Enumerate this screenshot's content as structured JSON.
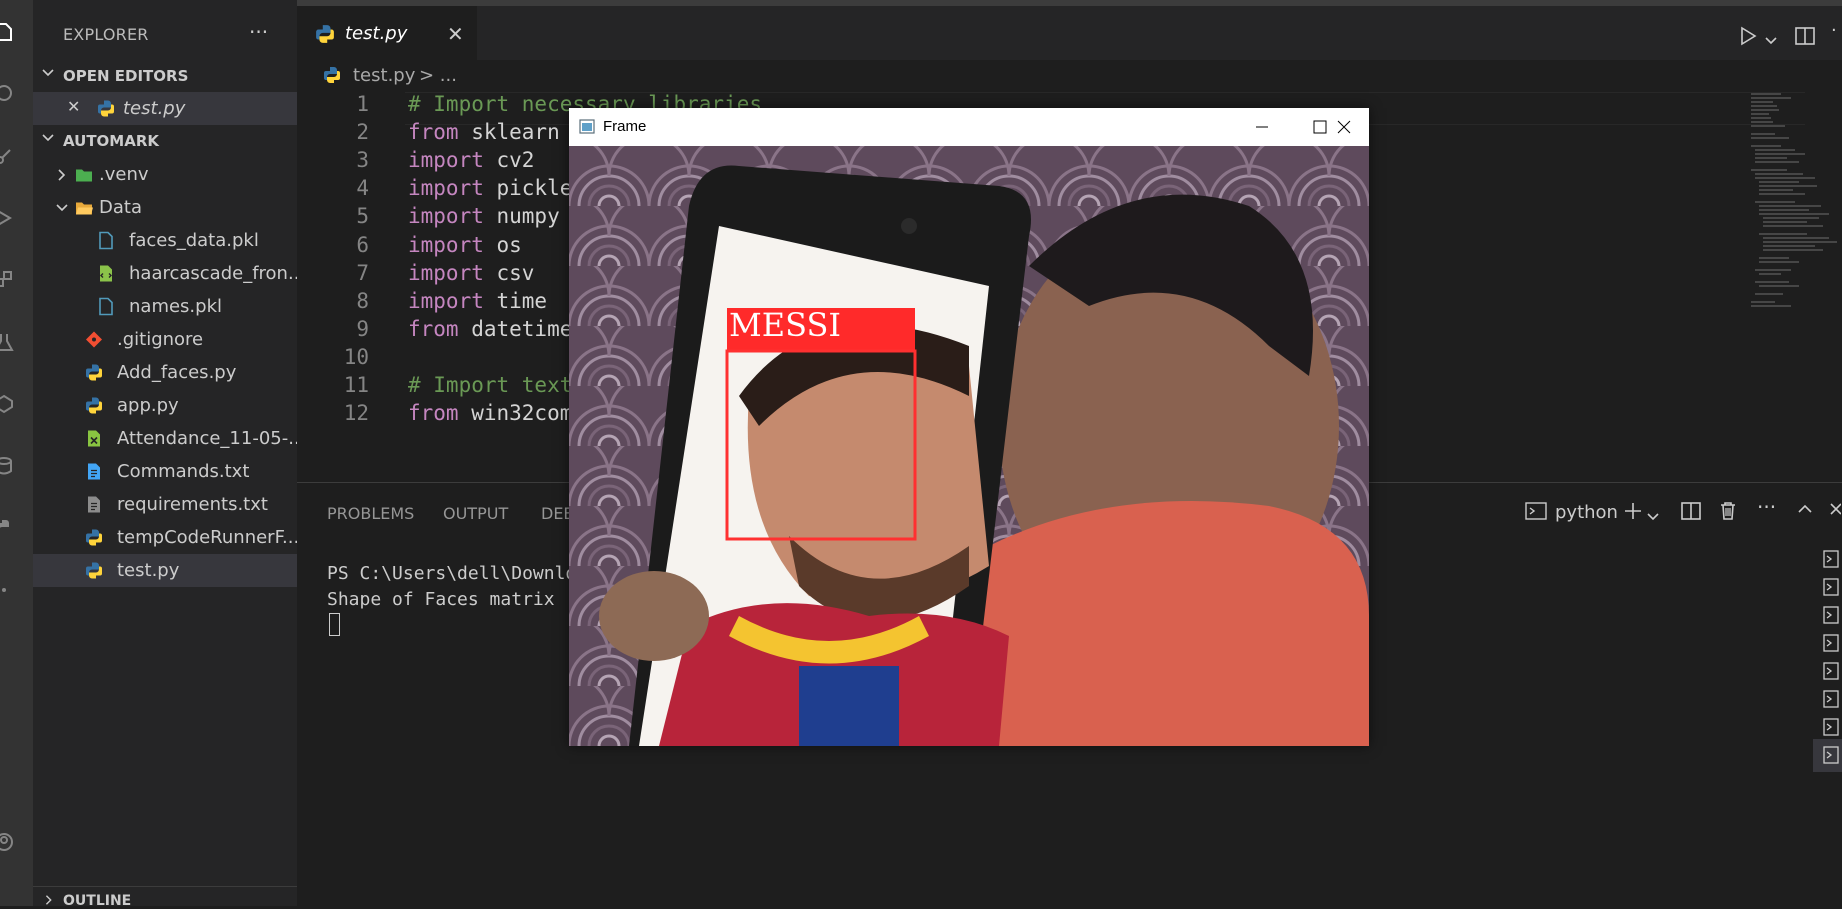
{
  "sidebar": {
    "title": "EXPLORER",
    "more_glyph": "···",
    "open_editors_label": "OPEN EDITORS",
    "open_editors": [
      {
        "name": "test.py",
        "icon": "python-file-icon",
        "close": "✕"
      }
    ],
    "workspace_label": "AUTOMARK",
    "tree": [
      {
        "name": ".venv",
        "icon": "folder-env-icon",
        "type": "folder",
        "expanded": false
      },
      {
        "name": "Data",
        "icon": "folder-open-icon",
        "type": "folder",
        "expanded": true
      },
      {
        "name": "faces_data.pkl",
        "icon": "file-icon",
        "type": "file"
      },
      {
        "name": "haarcascade_fron...",
        "icon": "xml-file-icon",
        "type": "file"
      },
      {
        "name": "names.pkl",
        "icon": "file-icon",
        "type": "file"
      },
      {
        "name": ".gitignore",
        "icon": "git-icon",
        "type": "file"
      },
      {
        "name": "Add_faces.py",
        "icon": "python-file-icon",
        "type": "file"
      },
      {
        "name": "app.py",
        "icon": "python-file-icon",
        "type": "file"
      },
      {
        "name": "Attendance_11-05-...",
        "icon": "csv-file-icon",
        "type": "file"
      },
      {
        "name": "Commands.txt",
        "icon": "text-file-icon",
        "type": "file"
      },
      {
        "name": "requirements.txt",
        "icon": "requirements-file-icon",
        "type": "file"
      },
      {
        "name": "tempCodeRunnerF...",
        "icon": "python-file-icon",
        "type": "file"
      },
      {
        "name": "test.py",
        "icon": "python-file-icon",
        "type": "file",
        "selected": true
      }
    ],
    "outline_label": "OUTLINE"
  },
  "editor": {
    "tab": {
      "name": "test.py",
      "close": "✕"
    },
    "breadcrumb": [
      "test.py",
      "> ..."
    ],
    "lines": [
      {
        "n": "1",
        "parts": [
          {
            "t": "# Import necessary libraries",
            "c": "cm"
          }
        ]
      },
      {
        "n": "2",
        "parts": [
          {
            "t": "from",
            "c": "kwp"
          },
          {
            "t": " sklearn",
            "c": ""
          }
        ]
      },
      {
        "n": "3",
        "parts": [
          {
            "t": "import",
            "c": "kwp"
          },
          {
            "t": " cv2",
            "c": ""
          }
        ]
      },
      {
        "n": "4",
        "parts": [
          {
            "t": "import",
            "c": "kwp"
          },
          {
            "t": " pickle",
            "c": ""
          }
        ]
      },
      {
        "n": "5",
        "parts": [
          {
            "t": "import",
            "c": "kwp"
          },
          {
            "t": " numpy",
            "c": ""
          }
        ]
      },
      {
        "n": "6",
        "parts": [
          {
            "t": "import",
            "c": "kwp"
          },
          {
            "t": " os",
            "c": ""
          }
        ]
      },
      {
        "n": "7",
        "parts": [
          {
            "t": "import",
            "c": "kwp"
          },
          {
            "t": " csv",
            "c": ""
          }
        ]
      },
      {
        "n": "8",
        "parts": [
          {
            "t": "import",
            "c": "kwp"
          },
          {
            "t": " time",
            "c": ""
          }
        ]
      },
      {
        "n": "9",
        "parts": [
          {
            "t": "from",
            "c": "kwp"
          },
          {
            "t": " datetime",
            "c": ""
          }
        ]
      },
      {
        "n": "10",
        "parts": []
      },
      {
        "n": "11",
        "parts": [
          {
            "t": "# Import text",
            "c": "cm"
          }
        ]
      },
      {
        "n": "12",
        "parts": [
          {
            "t": "from",
            "c": "kwp"
          },
          {
            "t": " win32com",
            "c": ""
          }
        ]
      }
    ]
  },
  "panel": {
    "tabs": [
      "PROBLEMS",
      "OUTPUT",
      "DEBUG CONSOLE"
    ],
    "terminal_name": "python",
    "terminal_lines": [
      "PS C:\\Users\\dell\\Downloads",
      "Shape of Faces matrix"
    ]
  },
  "frame_window": {
    "title": "Frame",
    "label": "MESSI",
    "colors": {
      "box": "#ff3030",
      "label_bg": "#ff2a2a",
      "label_text": "#ffffff"
    }
  },
  "colors": {
    "accent": "#007acc",
    "python_blue": "#3572a5",
    "python_yellow": "#ffd43b",
    "keyword": "#c586c0",
    "comment": "#6a9955"
  }
}
